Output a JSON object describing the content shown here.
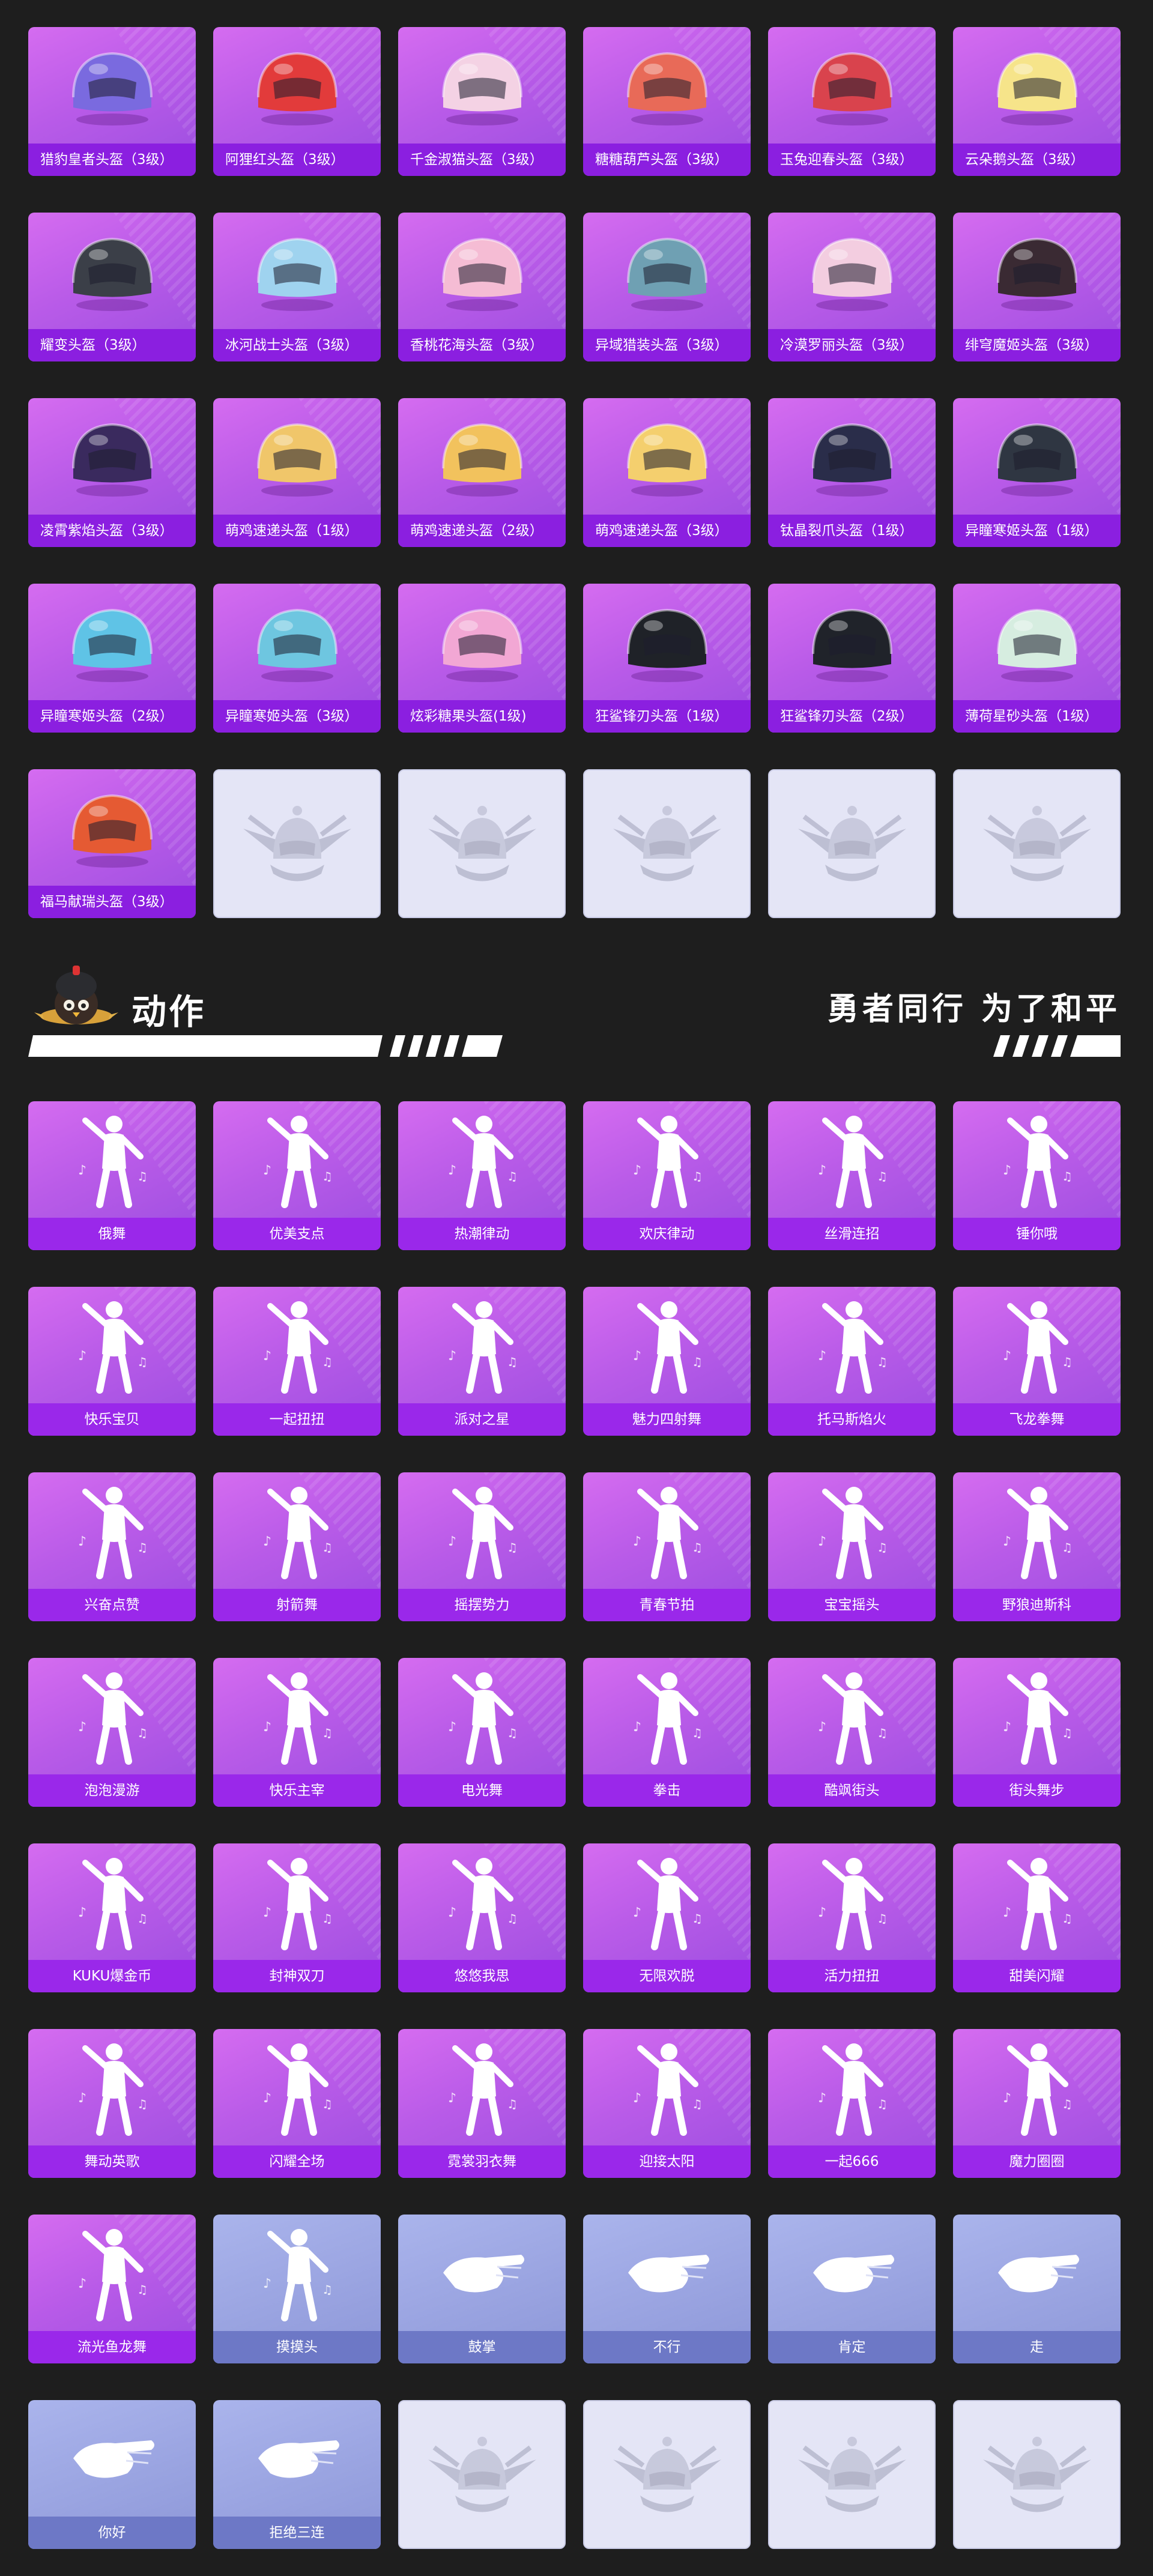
{
  "helmets": [
    {
      "label": "猎豹皇者头盔（3级）",
      "variant": "helmet",
      "icon": "helmet-icon",
      "accent": "#7a6adf"
    },
    {
      "label": "阿狸红头盔（3级）",
      "variant": "helmet",
      "icon": "helmet-icon",
      "accent": "#e23b3b"
    },
    {
      "label": "千金淑猫头盔（3级）",
      "variant": "helmet",
      "icon": "helmet-icon",
      "accent": "#f4d2e4"
    },
    {
      "label": "糖糖葫芦头盔（3级）",
      "variant": "helmet",
      "icon": "helmet-icon",
      "accent": "#e86a58"
    },
    {
      "label": "玉兔迎春头盔（3级）",
      "variant": "helmet",
      "icon": "helmet-icon",
      "accent": "#d9434d"
    },
    {
      "label": "云朵鹅头盔（3级）",
      "variant": "helmet",
      "icon": "helmet-icon",
      "accent": "#f6e48a"
    },
    {
      "label": "耀变头盔（3级）",
      "variant": "helmet",
      "icon": "helmet-icon",
      "accent": "#3b3f48"
    },
    {
      "label": "冰河战士头盔（3级）",
      "variant": "helmet",
      "icon": "helmet-icon",
      "accent": "#9fd3ef"
    },
    {
      "label": "香桃花海头盔（3级）",
      "variant": "helmet",
      "icon": "helmet-icon",
      "accent": "#f5bcd4"
    },
    {
      "label": "异域猎装头盔（3级）",
      "variant": "helmet",
      "icon": "helmet-icon",
      "accent": "#6fa0b3"
    },
    {
      "label": "冷漠罗丽头盔（3级）",
      "variant": "helmet",
      "icon": "helmet-icon",
      "accent": "#f3cde0"
    },
    {
      "label": "绯穹魔姬头盔（3级）",
      "variant": "helmet",
      "icon": "helmet-icon",
      "accent": "#3a2a33"
    },
    {
      "label": "凌霄紫焰头盔（3级）",
      "variant": "helmet",
      "icon": "helmet-icon",
      "accent": "#3a2a5e"
    },
    {
      "label": "萌鸡速递头盔（1级）",
      "variant": "helmet",
      "icon": "helmet-icon",
      "accent": "#f0c66a"
    },
    {
      "label": "萌鸡速递头盔（2级）",
      "variant": "helmet",
      "icon": "helmet-icon",
      "accent": "#f2c25d"
    },
    {
      "label": "萌鸡速递头盔（3级）",
      "variant": "helmet",
      "icon": "helmet-icon",
      "accent": "#f4cf6e"
    },
    {
      "label": "钛晶裂爪头盔（1级）",
      "variant": "helmet",
      "icon": "helmet-icon",
      "accent": "#2a2d4a"
    },
    {
      "label": "异瞳寒姬头盔（1级）",
      "variant": "helmet",
      "icon": "helmet-icon",
      "accent": "#2f3642"
    },
    {
      "label": "异瞳寒姬头盔（2级）",
      "variant": "helmet",
      "icon": "helmet-icon",
      "accent": "#5fc3e6"
    },
    {
      "label": "异瞳寒姬头盔（3级）",
      "variant": "helmet",
      "icon": "helmet-icon",
      "accent": "#6ec6e0"
    },
    {
      "label": "炫彩糖果头盔(1级)",
      "variant": "helmet",
      "icon": "helmet-icon",
      "accent": "#f2a7d4"
    },
    {
      "label": "狂鲨锋刃头盔（1级）",
      "variant": "helmet",
      "icon": "helmet-icon",
      "accent": "#1f2228"
    },
    {
      "label": "狂鲨锋刃头盔（2级）",
      "variant": "helmet",
      "icon": "helmet-icon",
      "accent": "#20232a"
    },
    {
      "label": "薄荷星砂头盔（1级）",
      "variant": "helmet",
      "icon": "helmet-icon",
      "accent": "#d6ede0"
    },
    {
      "label": "福马献瑞头盔（3级）",
      "variant": "helmet",
      "icon": "helmet-icon",
      "accent": "#e55a33"
    },
    {
      "label": "",
      "variant": "empty",
      "icon": "pubg-emblem-icon",
      "accent": "#c7c9df"
    },
    {
      "label": "",
      "variant": "empty",
      "icon": "pubg-emblem-icon",
      "accent": "#c7c9df"
    },
    {
      "label": "",
      "variant": "empty",
      "icon": "pubg-emblem-icon",
      "accent": "#c7c9df"
    },
    {
      "label": "",
      "variant": "empty",
      "icon": "pubg-emblem-icon",
      "accent": "#c7c9df"
    },
    {
      "label": "",
      "variant": "empty",
      "icon": "pubg-emblem-icon",
      "accent": "#c7c9df"
    }
  ],
  "section": {
    "title": "动作",
    "slogan": "勇者同行 为了和平",
    "mascot_icon": "chicken-mascot-icon"
  },
  "actions": [
    {
      "label": "俄舞",
      "variant": "purple",
      "icon": "dancer-icon"
    },
    {
      "label": "优美支点",
      "variant": "purple",
      "icon": "dancer-icon"
    },
    {
      "label": "热潮律动",
      "variant": "purple",
      "icon": "dancer-icon"
    },
    {
      "label": "欢庆律动",
      "variant": "purple",
      "icon": "dancer-icon"
    },
    {
      "label": "丝滑连招",
      "variant": "purple",
      "icon": "dancer-icon"
    },
    {
      "label": "锤你哦",
      "variant": "purple",
      "icon": "dancer-icon"
    },
    {
      "label": "快乐宝贝",
      "variant": "purple",
      "icon": "dancer-icon"
    },
    {
      "label": "一起扭扭",
      "variant": "purple",
      "icon": "dancer-icon"
    },
    {
      "label": "派对之星",
      "variant": "purple",
      "icon": "dancer-icon"
    },
    {
      "label": "魅力四射舞",
      "variant": "purple",
      "icon": "dancer-icon"
    },
    {
      "label": "托马斯焰火",
      "variant": "purple",
      "icon": "dancer-icon"
    },
    {
      "label": "飞龙拳舞",
      "variant": "purple",
      "icon": "dancer-icon"
    },
    {
      "label": "兴奋点赞",
      "variant": "purple",
      "icon": "dancer-icon"
    },
    {
      "label": "射箭舞",
      "variant": "purple",
      "icon": "dancer-icon"
    },
    {
      "label": "摇摆势力",
      "variant": "purple",
      "icon": "dancer-icon"
    },
    {
      "label": "青春节拍",
      "variant": "purple",
      "icon": "dancer-icon"
    },
    {
      "label": "宝宝摇头",
      "variant": "purple",
      "icon": "dancer-icon"
    },
    {
      "label": "野狼迪斯科",
      "variant": "purple",
      "icon": "dancer-icon"
    },
    {
      "label": "泡泡漫游",
      "variant": "purple",
      "icon": "dancer-icon"
    },
    {
      "label": "快乐主宰",
      "variant": "purple",
      "icon": "dancer-icon"
    },
    {
      "label": "电光舞",
      "variant": "purple",
      "icon": "dancer-icon"
    },
    {
      "label": "拳击",
      "variant": "purple",
      "icon": "dancer-icon"
    },
    {
      "label": "酷飒街头",
      "variant": "purple",
      "icon": "dancer-icon"
    },
    {
      "label": "街头舞步",
      "variant": "purple",
      "icon": "dancer-icon"
    },
    {
      "label": "KUKU爆金币",
      "variant": "purple",
      "icon": "dancer-icon"
    },
    {
      "label": "封神双刀",
      "variant": "purple",
      "icon": "dancer-icon"
    },
    {
      "label": "悠悠我思",
      "variant": "purple",
      "icon": "dancer-icon"
    },
    {
      "label": "无限欢脱",
      "variant": "purple",
      "icon": "dancer-icon"
    },
    {
      "label": "活力扭扭",
      "variant": "purple",
      "icon": "dancer-icon"
    },
    {
      "label": "甜美闪耀",
      "variant": "purple",
      "icon": "dancer-icon"
    },
    {
      "label": "舞动英歌",
      "variant": "purple",
      "icon": "dancer-icon"
    },
    {
      "label": "闪耀全场",
      "variant": "purple",
      "icon": "dancer-icon"
    },
    {
      "label": "霓裳羽衣舞",
      "variant": "purple",
      "icon": "dancer-icon"
    },
    {
      "label": "迎接太阳",
      "variant": "purple",
      "icon": "dancer-icon"
    },
    {
      "label": "一起666",
      "variant": "purple",
      "icon": "dancer-icon"
    },
    {
      "label": "魔力圈圈",
      "variant": "purple",
      "icon": "dancer-icon"
    },
    {
      "label": "流光鱼龙舞",
      "variant": "purple",
      "icon": "dancer-icon"
    },
    {
      "label": "摸摸头",
      "variant": "blue",
      "icon": "dancer-icon"
    },
    {
      "label": "鼓掌",
      "variant": "blue",
      "icon": "clap-hands-icon"
    },
    {
      "label": "不行",
      "variant": "blue",
      "icon": "shake-head-icon"
    },
    {
      "label": "肯定",
      "variant": "blue",
      "icon": "nod-head-icon"
    },
    {
      "label": "走",
      "variant": "blue",
      "icon": "point-hand-icon"
    },
    {
      "label": "你好",
      "variant": "blue",
      "icon": "wave-hand-icon"
    },
    {
      "label": "拒绝三连",
      "variant": "blue",
      "icon": "crossed-arms-icon"
    },
    {
      "label": "",
      "variant": "empty",
      "icon": "pubg-emblem-icon"
    },
    {
      "label": "",
      "variant": "empty",
      "icon": "pubg-emblem-icon"
    },
    {
      "label": "",
      "variant": "empty",
      "icon": "pubg-emblem-icon"
    },
    {
      "label": "",
      "variant": "empty",
      "icon": "pubg-emblem-icon"
    }
  ]
}
